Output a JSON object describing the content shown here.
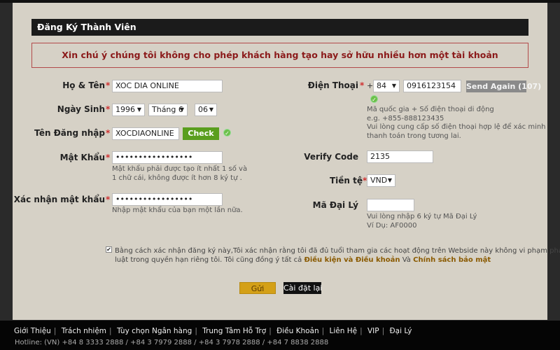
{
  "title": "Đăng Ký Thành Viên",
  "notice": "Xin chú ý chúng tôi không cho phép khách hàng tạo hay sở hữu nhiều hơn một tài khoản",
  "required_mark": "*",
  "left": {
    "fullname": {
      "label": "Họ & Tên",
      "value": "XOC DIA ONLINE"
    },
    "birthday": {
      "label": "Ngày Sinh",
      "year": "1996",
      "month": "Tháng 6",
      "day": "06"
    },
    "username": {
      "label": "Tên Đăng nhập",
      "value": "XOCDIAONLINE",
      "check_label": "Check"
    },
    "password": {
      "label": "Mật Khẩu",
      "value": "•••••••••••••••••",
      "hint1": "Mật khẩu phải được tạo ít nhất 1 số và",
      "hint2": "1 chữ cái, không được ít hơn 8 ký tự ."
    },
    "confirm": {
      "label": "Xác nhận mật khẩu",
      "value": "•••••••••••••••••",
      "hint": "Nhập mật khẩu của bạn một lần nữa."
    }
  },
  "right": {
    "phone": {
      "label": "Điện Thoại",
      "plus": "+",
      "country_code": "84",
      "value": "0916123154",
      "send_again": "Send Again (107)",
      "hint1": "Mã quốc gia + Số điện thoại di động",
      "hint2": "e.g. +855-888123435",
      "hint3": "Vui lòng cung cấp số điện thoại hợp lệ để xác minh",
      "hint4": "thanh toán trong tương lai."
    },
    "verify": {
      "label": "Verify Code",
      "value": "2135"
    },
    "currency": {
      "label": "Tiền tệ",
      "value": "VND"
    },
    "agent": {
      "label": "Mã Đại Lý",
      "value": "",
      "hint1": "Vui lòng nhập 6 ký tự Mã Đại Lý",
      "hint2": "Ví Dụ: AF0000"
    }
  },
  "agreement": {
    "checked": true,
    "line1": "Bằng cách xác nhận đăng ký này,Tôi xác nhận rằng tôi đã đủ tuổi tham gia các hoạt động trên Webside này không vi phạm pháp",
    "line2_pre": "luật trong quyền hạn riêng tôi. Tôi cũng đồng ý tất cả ",
    "terms": "Điều kiện và Điều khoản",
    "and": " Và ",
    "privacy": "Chính sách bảo mật"
  },
  "buttons": {
    "submit": "Gửi",
    "reset": "Cài đặt lại"
  },
  "footer": {
    "links": [
      "Giới Thiệu",
      "Trách nhiệm",
      "Tùy chọn Ngân hàng",
      "Trung Tâm Hỗ Trợ",
      "Điều Khoản",
      "Liên Hệ",
      "VIP",
      "Đại Lý"
    ],
    "separator": "|",
    "hotline": "Hotline: (VN) +84 8 3333 2888 / +84 3 7979 2888 / +84 3 7978 2888 / +84 7 8838 2888"
  },
  "colors": {
    "panel": "#d6d1c6",
    "notice_text": "#8b1a1a",
    "check_button": "#5a9e1e",
    "submit": "#d4a017",
    "link": "#8a5a00"
  },
  "icons": {
    "valid": "check-circle-icon",
    "dropdown": "triangle-down-icon"
  }
}
